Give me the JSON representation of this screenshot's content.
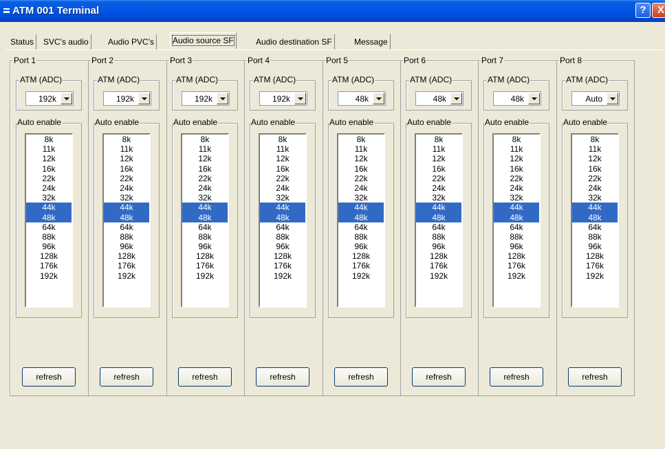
{
  "window": {
    "title": "ATM 001 Terminal",
    "help_label": "?",
    "close_label": "X"
  },
  "tabs": [
    {
      "label": "Status",
      "selected": false
    },
    {
      "label": "SVC's audio",
      "selected": false
    },
    {
      "label": "Audio PVC's",
      "selected": false
    },
    {
      "label": "Audio source SF",
      "selected": true
    },
    {
      "label": "Audio destination SF",
      "selected": false
    },
    {
      "label": "Message",
      "selected": false
    }
  ],
  "labels": {
    "atm_adc": "ATM (ADC)",
    "auto_enable": "Auto enable",
    "refresh": "refresh"
  },
  "rates": [
    "8k",
    "11k",
    "12k",
    "16k",
    "22k",
    "24k",
    "32k",
    "44k",
    "48k",
    "64k",
    "88k",
    "96k",
    "128k",
    "176k",
    "192k"
  ],
  "ports": [
    {
      "name": "Port 1",
      "adc_value": "192k",
      "selected_rates": [
        "44k",
        "48k"
      ]
    },
    {
      "name": "Port 2",
      "adc_value": "192k",
      "selected_rates": [
        "44k",
        "48k"
      ]
    },
    {
      "name": "Port 3",
      "adc_value": "192k",
      "selected_rates": [
        "44k",
        "48k"
      ]
    },
    {
      "name": "Port 4",
      "adc_value": "192k",
      "selected_rates": [
        "44k",
        "48k"
      ]
    },
    {
      "name": "Port 5",
      "adc_value": "48k",
      "selected_rates": [
        "44k",
        "48k"
      ]
    },
    {
      "name": "Port 6",
      "adc_value": "48k",
      "selected_rates": [
        "44k",
        "48k"
      ]
    },
    {
      "name": "Port 7",
      "adc_value": "48k",
      "selected_rates": [
        "44k",
        "48k"
      ]
    },
    {
      "name": "Port 8",
      "adc_value": "Auto",
      "selected_rates": [
        "44k",
        "48k"
      ]
    }
  ]
}
